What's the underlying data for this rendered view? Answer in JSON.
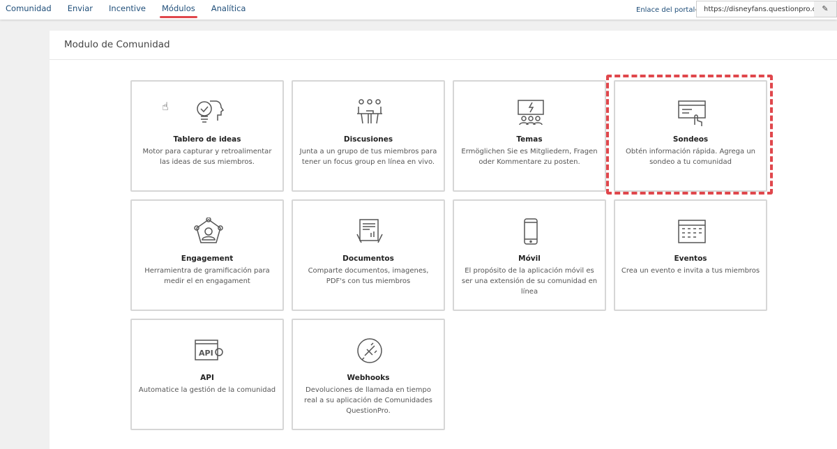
{
  "nav": {
    "items": [
      "Comunidad",
      "Enviar",
      "Incentive",
      "Módulos",
      "Analítica"
    ],
    "active": "Módulos"
  },
  "portal": {
    "label": "Enlace del portal",
    "url": "https://disneyfans.questionpro.com"
  },
  "page": {
    "title": "Modulo de Comunidad"
  },
  "colors": {
    "accent": "#e0474c",
    "nav": "#1f4e79"
  },
  "modules": [
    {
      "icon": "lightbulb-head-icon",
      "title": "Tablero de ideas",
      "desc": "Motor para capturar y retroalimentar las ideas de sus miembros."
    },
    {
      "icon": "meeting-icon",
      "title": "Discusiones",
      "desc": "Junta a un grupo de tus miembros para tener un focus group en línea en vivo."
    },
    {
      "icon": "presentation-icon",
      "title": "Temas",
      "desc": "Ermöglichen Sie es Mitgliedern, Fragen oder Kommentare zu posten."
    },
    {
      "icon": "survey-card-icon",
      "title": "Sondeos",
      "desc": "Obtén información rápida. Agrega un sondeo a tu comunidad"
    },
    {
      "icon": "network-user-icon",
      "title": "Engagement",
      "desc": "Herramientra de gramificación para medir el en engagament"
    },
    {
      "icon": "documents-icon",
      "title": "Documentos",
      "desc": "Comparte documentos, imagenes, PDF's con tus miembros"
    },
    {
      "icon": "mobile-icon",
      "title": "Móvil",
      "desc": "El propósito de la aplicación móvil es ser una extensión de su comunidad en línea"
    },
    {
      "icon": "calendar-icon",
      "title": "Eventos",
      "desc": "Crea un evento e invita a tus miembros"
    },
    {
      "icon": "api-icon",
      "title": "API",
      "desc": "Automatice la gestión de la comunidad"
    },
    {
      "icon": "plug-icon",
      "title": "Webhooks",
      "desc": "Devoluciones de llamada en tiempo real a su aplicación de Comunidades QuestionPro."
    }
  ]
}
